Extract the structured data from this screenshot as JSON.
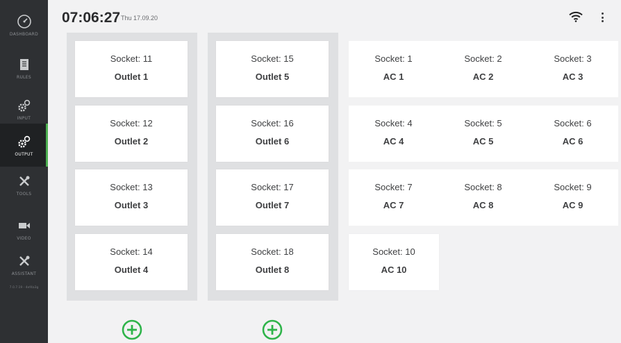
{
  "sidebar": {
    "items": [
      {
        "label": "DASHBOARD",
        "icon": "gauge-icon"
      },
      {
        "label": "RULES",
        "icon": "document-icon"
      },
      {
        "label": "INPUT",
        "icon": "cog-input-icon"
      },
      {
        "label": "OUTPUT",
        "icon": "cog-output-icon",
        "active": true
      },
      {
        "label": "TOOLS",
        "icon": "tools-icon"
      },
      {
        "label": "VIDEO",
        "icon": "video-camera-icon"
      },
      {
        "label": "ASSISTANT",
        "icon": "assistant-tools-icon"
      }
    ],
    "version": "7.0.7.19 - 4ef4a3g"
  },
  "header": {
    "time": "07:06:27",
    "date": "Thu 17.09.20"
  },
  "colors": {
    "accent": "#4caf50",
    "sidebar_bg": "#2e3033",
    "group_bg": "#dfe0e2"
  },
  "groups": [
    {
      "cards": [
        {
          "socket": "Socket: 11",
          "name": "Outlet 1"
        },
        {
          "socket": "Socket: 12",
          "name": "Outlet 2"
        },
        {
          "socket": "Socket: 13",
          "name": "Outlet 3"
        },
        {
          "socket": "Socket: 14",
          "name": "Outlet 4"
        }
      ]
    },
    {
      "cards": [
        {
          "socket": "Socket: 15",
          "name": "Outlet 5"
        },
        {
          "socket": "Socket: 16",
          "name": "Outlet 6"
        },
        {
          "socket": "Socket: 17",
          "name": "Outlet 7"
        },
        {
          "socket": "Socket: 18",
          "name": "Outlet 8"
        }
      ]
    }
  ],
  "ac": [
    {
      "socket": "Socket: 1",
      "name": "AC 1"
    },
    {
      "socket": "Socket: 2",
      "name": "AC 2"
    },
    {
      "socket": "Socket: 3",
      "name": "AC 3"
    },
    {
      "socket": "Socket: 4",
      "name": "AC 4"
    },
    {
      "socket": "Socket: 5",
      "name": "AC 5"
    },
    {
      "socket": "Socket: 6",
      "name": "AC 6"
    },
    {
      "socket": "Socket: 7",
      "name": "AC 7"
    },
    {
      "socket": "Socket: 8",
      "name": "AC 8"
    },
    {
      "socket": "Socket: 9",
      "name": "AC 9"
    },
    {
      "socket": "Socket: 10",
      "name": "AC 10"
    }
  ]
}
